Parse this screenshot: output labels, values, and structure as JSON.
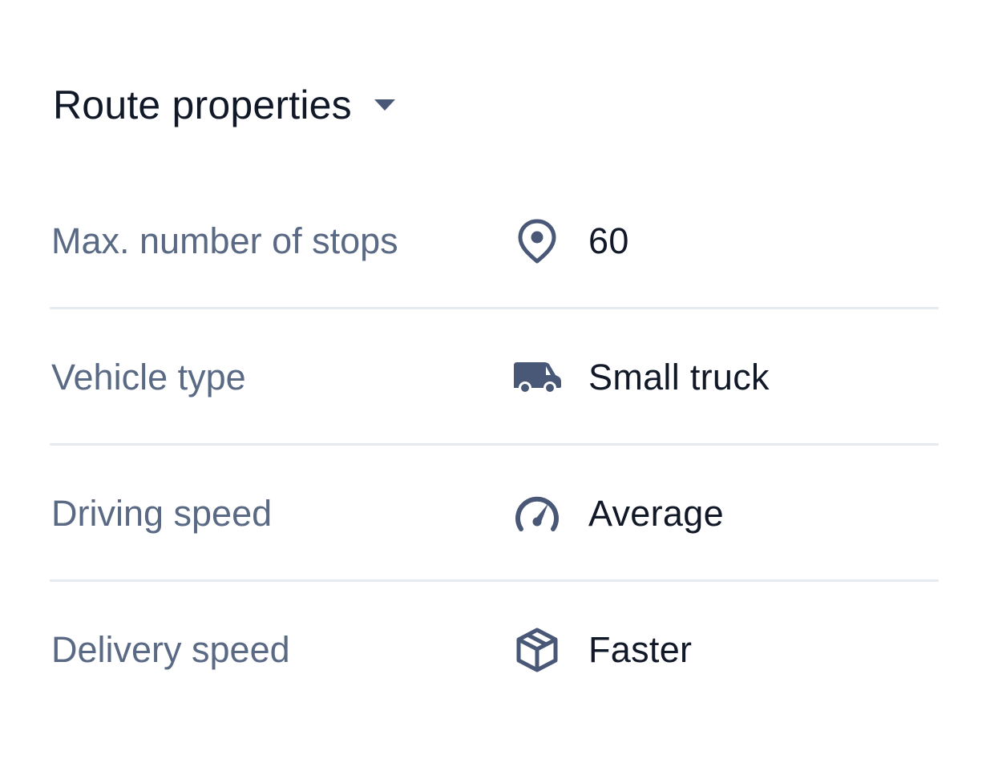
{
  "header": {
    "title": "Route properties",
    "caret_icon": "caret-down-icon"
  },
  "colors": {
    "title": "#111827",
    "label": "#5a6a85",
    "value": "#111827",
    "icon": "#4a5878",
    "divider": "#e6ebf2"
  },
  "rows": [
    {
      "label": "Max. number of stops",
      "icon": "map-pin-icon",
      "value": "60"
    },
    {
      "label": "Vehicle type",
      "icon": "truck-icon",
      "value": "Small truck"
    },
    {
      "label": "Driving speed",
      "icon": "speedometer-icon",
      "value": "Average"
    },
    {
      "label": "Delivery speed",
      "icon": "package-icon",
      "value": "Faster"
    }
  ]
}
